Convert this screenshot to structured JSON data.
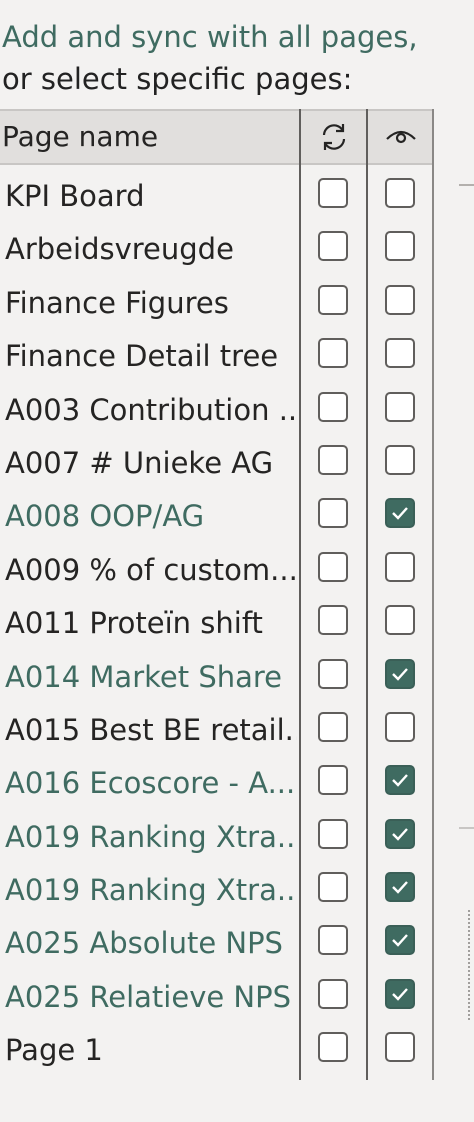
{
  "instructions": {
    "line1": "Add and sync with all pages,",
    "line2": "or select specific pages:"
  },
  "table": {
    "header": {
      "name": "Page name",
      "sync_icon": "sync-icon",
      "visibility_icon": "eye-icon"
    },
    "rows": [
      {
        "name": "KPI Board",
        "sync": false,
        "visible": false
      },
      {
        "name": "Arbeidsvreugde",
        "sync": false,
        "visible": false
      },
      {
        "name": "Finance Figures",
        "sync": false,
        "visible": false
      },
      {
        "name": "Finance Detail tree",
        "sync": false,
        "visible": false
      },
      {
        "name": "A003 Contribution ...",
        "sync": false,
        "visible": false
      },
      {
        "name": "A007 # Unieke AG",
        "sync": false,
        "visible": false
      },
      {
        "name": "A008 OOP/AG",
        "sync": false,
        "visible": true
      },
      {
        "name": "A009 % of custom...",
        "sync": false,
        "visible": false
      },
      {
        "name": "A011 Proteïn shift",
        "sync": false,
        "visible": false
      },
      {
        "name": "A014 Market Share",
        "sync": false,
        "visible": true
      },
      {
        "name": "A015 Best BE retail...",
        "sync": false,
        "visible": false
      },
      {
        "name": "A016 Ecoscore - A...",
        "sync": false,
        "visible": true
      },
      {
        "name": "A019 Ranking Xtra...",
        "sync": false,
        "visible": true
      },
      {
        "name": "A019 Ranking Xtra...",
        "sync": false,
        "visible": true
      },
      {
        "name": "A025 Absolute NPS",
        "sync": false,
        "visible": true
      },
      {
        "name": "A025 Relatieve NPS",
        "sync": false,
        "visible": true
      },
      {
        "name": "Page 1",
        "sync": false,
        "visible": false
      }
    ]
  },
  "colors": {
    "accent": "#3f6b61",
    "text": "#252423",
    "background": "#f3f2f1",
    "header_bg": "#e1dfdd"
  }
}
